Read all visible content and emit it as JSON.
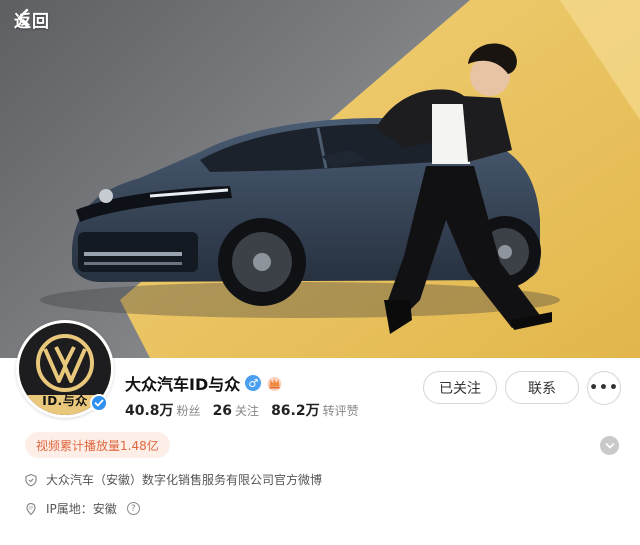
{
  "nav": {
    "back_label": "返回"
  },
  "profile": {
    "name": "大众汽车ID与众",
    "gender_symbol": "♂",
    "avatar_text": "ID.与众",
    "stats": [
      {
        "value": "40.8万",
        "label": "粉丝"
      },
      {
        "value": "26",
        "label": "关注"
      },
      {
        "value": "86.2万",
        "label": "转评赞"
      }
    ],
    "buttons": {
      "following": "已关注",
      "contact": "联系",
      "more": "•••"
    },
    "tag": "视频累计播放量1.48亿",
    "verification": "大众汽车（安徽）数字化销售服务有限公司官方微博",
    "ip_location": "IP属地：安徽"
  },
  "colors": {
    "accent_orange": "#e0673d",
    "tag_bg": "#fdeee8",
    "verified_blue": "#2d8ff0",
    "banner_yellow": "#e9c15a"
  }
}
